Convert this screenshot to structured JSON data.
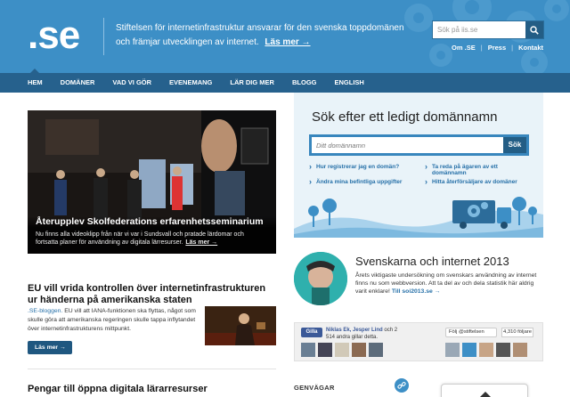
{
  "header": {
    "logo": ".se",
    "tagline": "Stiftelsen för internetinfrastruktur ansvarar för den svenska toppdomänen och främjar utvecklingen av internet.",
    "tagline_more": "Läs mer →",
    "search_placeholder": "Sök på iis.se",
    "links": [
      "Om .SE",
      "Press",
      "Kontakt"
    ],
    "link_separator": "|",
    "bg_color": "#3d8fc6"
  },
  "nav": {
    "items": [
      "HEM",
      "DOMÄNER",
      "VAD VI GÖR",
      "EVENEMANG",
      "LÄR DIG MER",
      "BLOGG",
      "ENGLISH"
    ],
    "active": "HEM",
    "bg_color": "#26618d"
  },
  "hero": {
    "title": "Återupplev Skolfederations erfarenhetsseminarium",
    "body": "Nu finns alla videoklipp från när vi var i Sundsvall och pratade lärdomar och fortsatta planer för användning av digitala lärresurser.",
    "more": "Läs mer →"
  },
  "article1": {
    "title": "EU vill vrida kontrollen över internetinfrastrukturen ur händerna på amerikanska staten",
    "source": ".SE-bloggen.",
    "body": " EU vill att IANA-funktionen ska flyttas, något som skulle göra att amerikanska regeringen skulle tappa inflytandet över internetinfrastrukturens mittpunkt.",
    "button": "Läs mer →"
  },
  "article2": {
    "title": "Pengar till öppna digitala lärarresurser"
  },
  "domain_search": {
    "title": "Sök efter ett ledigt domännamn",
    "placeholder": "Ditt domännamn",
    "button": "Sök",
    "links": [
      "Hur registrerar jag en domän?",
      "Ta reda på ägaren av ett domännamn",
      "Ändra mina befintliga uppgifter",
      "Hitta återförsäljare av domäner"
    ]
  },
  "internet2013": {
    "title": "Svenskarna och internet 2013",
    "body": "Årets viktigaste undersökning om svenskars användning av internet finns nu som webbversion. Att ta del av och dela statistik här aldrig varit enklare!",
    "link": "Till soi2013.se →"
  },
  "social": {
    "fb_button": "Gilla",
    "fb_names": "Niklas Ek, Jesper Lind",
    "fb_rest": " och 2 514 andra gillar detta.",
    "tw_button": "Följ @stiftelsen",
    "tw_count": "4,310 följare"
  },
  "shortcuts": {
    "title": "GENVÄGAR"
  }
}
